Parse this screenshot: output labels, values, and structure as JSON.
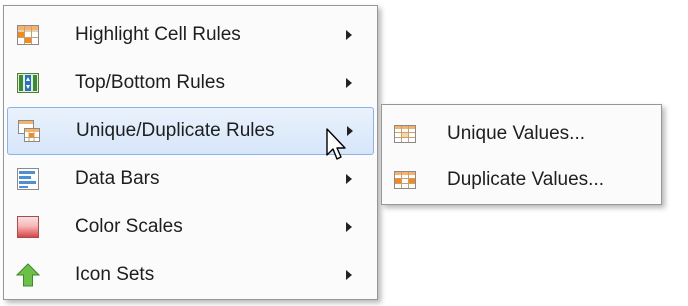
{
  "main_menu": {
    "items": [
      {
        "label": "Highlight Cell Rules",
        "icon": "highlight-cell-rules-icon",
        "has_submenu": true
      },
      {
        "label": "Top/Bottom Rules",
        "icon": "top-bottom-rules-icon",
        "has_submenu": true
      },
      {
        "label": "Unique/Duplicate Rules",
        "icon": "unique-duplicate-rules-icon",
        "has_submenu": true,
        "active": true
      },
      {
        "label": "Data Bars",
        "icon": "data-bars-icon",
        "has_submenu": true
      },
      {
        "label": "Color Scales",
        "icon": "color-scales-icon",
        "has_submenu": true
      },
      {
        "label": "Icon Sets",
        "icon": "icon-sets-icon",
        "has_submenu": true
      }
    ]
  },
  "sub_menu": {
    "items": [
      {
        "label": "Unique Values...",
        "icon": "unique-values-icon"
      },
      {
        "label": "Duplicate Values...",
        "icon": "duplicate-values-icon"
      }
    ]
  },
  "colors": {
    "highlight_bg": "#d6e6fa",
    "highlight_border": "#8db2e3",
    "menu_border": "#979797",
    "orange": "#f28a1e",
    "blue": "#4f8fd6",
    "red": "#e05a5a",
    "green": "#6cc04a"
  }
}
